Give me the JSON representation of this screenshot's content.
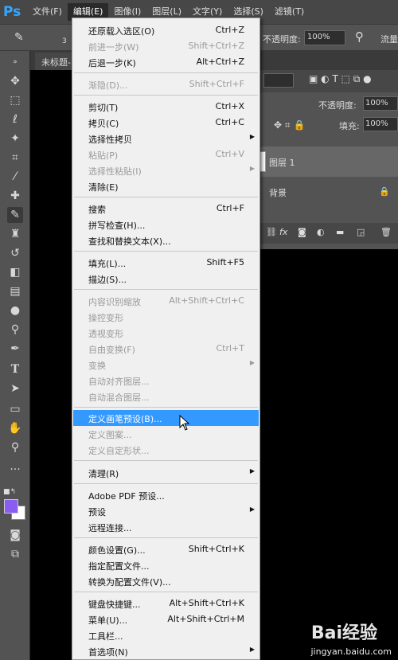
{
  "app": {
    "logo": "Ps"
  },
  "menubar": {
    "items": [
      "文件(F)",
      "编辑(E)",
      "图像(I)",
      "图层(L)",
      "文字(Y)",
      "选择(S)",
      "滤镜(T)"
    ]
  },
  "options": {
    "size": "3",
    "opacity_label": "不透明度:",
    "opacity_value": "100%",
    "flow_label": "流量"
  },
  "doc_tab": {
    "title": "未标题-"
  },
  "layers_panel": {
    "opacity_label": "不透明度:",
    "opacity_value": "100%",
    "lock_label": "锁定:",
    "fill_label": "填充:",
    "fill_value": "100%",
    "layers": [
      "图层 1",
      "背景"
    ],
    "footer_icons": [
      "link-icon",
      "fx-icon",
      "mask-icon",
      "adjustment-icon",
      "folder-icon",
      "new-layer-icon",
      "trash-icon"
    ]
  },
  "edit_menu": {
    "items": [
      {
        "label": "还原载入选区(O)",
        "shortcut": "Ctrl+Z",
        "disabled": false
      },
      {
        "label": "前进一步(W)",
        "shortcut": "Shift+Ctrl+Z",
        "disabled": true
      },
      {
        "label": "后退一步(K)",
        "shortcut": "Alt+Ctrl+Z",
        "disabled": false
      },
      {
        "label": "渐隐(D)...",
        "shortcut": "Shift+Ctrl+F",
        "disabled": true
      },
      {
        "label": "剪切(T)",
        "shortcut": "Ctrl+X",
        "disabled": false
      },
      {
        "label": "拷贝(C)",
        "shortcut": "Ctrl+C",
        "disabled": false
      },
      {
        "label": "选择性拷贝",
        "shortcut": "",
        "disabled": false,
        "submenu": true
      },
      {
        "label": "粘贴(P)",
        "shortcut": "Ctrl+V",
        "disabled": true
      },
      {
        "label": "选择性粘贴(I)",
        "shortcut": "",
        "disabled": true,
        "submenu": true
      },
      {
        "label": "清除(E)",
        "shortcut": "",
        "disabled": false
      },
      {
        "label": "搜索",
        "shortcut": "Ctrl+F",
        "disabled": false
      },
      {
        "label": "拼写检查(H)...",
        "shortcut": "",
        "disabled": false
      },
      {
        "label": "查找和替换文本(X)...",
        "shortcut": "",
        "disabled": false
      },
      {
        "label": "填充(L)...",
        "shortcut": "Shift+F5",
        "disabled": false
      },
      {
        "label": "描边(S)...",
        "shortcut": "",
        "disabled": false
      },
      {
        "label": "内容识别缩放",
        "shortcut": "Alt+Shift+Ctrl+C",
        "disabled": true
      },
      {
        "label": "操控变形",
        "shortcut": "",
        "disabled": true
      },
      {
        "label": "透视变形",
        "shortcut": "",
        "disabled": true
      },
      {
        "label": "自由变换(F)",
        "shortcut": "Ctrl+T",
        "disabled": true
      },
      {
        "label": "变换",
        "shortcut": "",
        "disabled": true,
        "submenu": true
      },
      {
        "label": "自动对齐图层...",
        "shortcut": "",
        "disabled": true
      },
      {
        "label": "自动混合图层...",
        "shortcut": "",
        "disabled": true
      },
      {
        "label": "定义画笔预设(B)...",
        "shortcut": "",
        "disabled": false,
        "highlighted": true
      },
      {
        "label": "定义图案...",
        "shortcut": "",
        "disabled": true
      },
      {
        "label": "定义自定形状...",
        "shortcut": "",
        "disabled": true
      },
      {
        "label": "清理(R)",
        "shortcut": "",
        "disabled": false,
        "submenu": true
      },
      {
        "label": "Adobe PDF 预设...",
        "shortcut": "",
        "disabled": false
      },
      {
        "label": "预设",
        "shortcut": "",
        "disabled": false,
        "submenu": true
      },
      {
        "label": "远程连接...",
        "shortcut": "",
        "disabled": false
      },
      {
        "label": "颜色设置(G)...",
        "shortcut": "Shift+Ctrl+K",
        "disabled": false
      },
      {
        "label": "指定配置文件...",
        "shortcut": "",
        "disabled": false
      },
      {
        "label": "转换为配置文件(V)...",
        "shortcut": "",
        "disabled": false
      },
      {
        "label": "键盘快捷键...",
        "shortcut": "Alt+Shift+Ctrl+K",
        "disabled": false
      },
      {
        "label": "菜单(U)...",
        "shortcut": "Alt+Shift+Ctrl+M",
        "disabled": false
      },
      {
        "label": "工具栏...",
        "shortcut": "",
        "disabled": false
      },
      {
        "label": "首选项(N)",
        "shortcut": "",
        "disabled": false,
        "submenu": true
      }
    ]
  },
  "watermark": {
    "brand": "Bai经验",
    "url": "jingyan.baidu.com"
  },
  "colors": {
    "foreground": "#8a5cf0",
    "background": "#ffffff",
    "highlight": "#3399ff"
  }
}
